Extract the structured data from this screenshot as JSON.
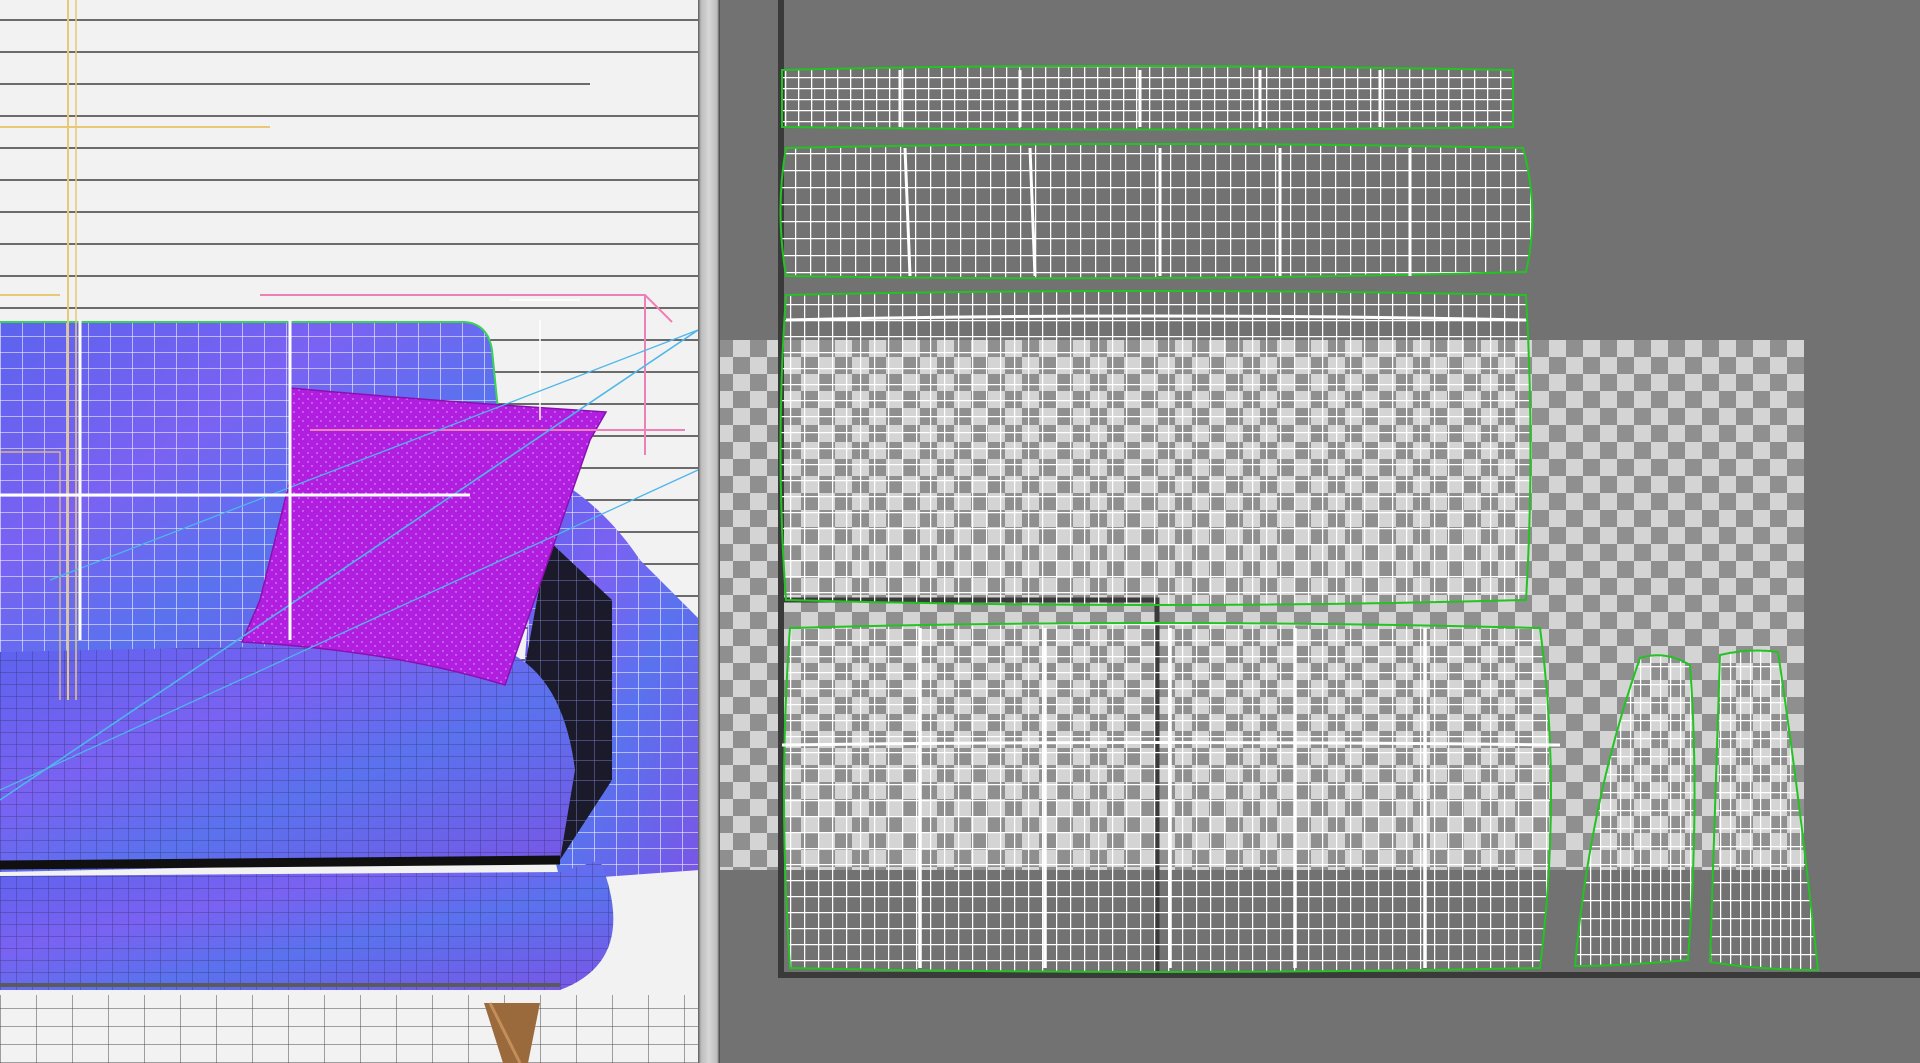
{
  "viewport": {
    "label": "",
    "colors": {
      "background": "#f2f2f2",
      "blinds": "#3e3e3e",
      "sofa_fill": "#6a66f0",
      "sofa_wire": "#ffffff",
      "pillow": "#b21ee0",
      "legs": "#9a6a3c",
      "light_gizmo": "#e8c777",
      "camera_gizmo": "#ee80b8",
      "target_line": "#4fb6ea"
    }
  },
  "uv_editor": {
    "label": "",
    "colors": {
      "background": "#727272",
      "checker_light": "#d4d4d4",
      "checker_dark": "#8f8f8f",
      "uv_wire": "#ffffff",
      "island_border": "#22c322",
      "bounds_line": "#3a3a3a"
    }
  }
}
